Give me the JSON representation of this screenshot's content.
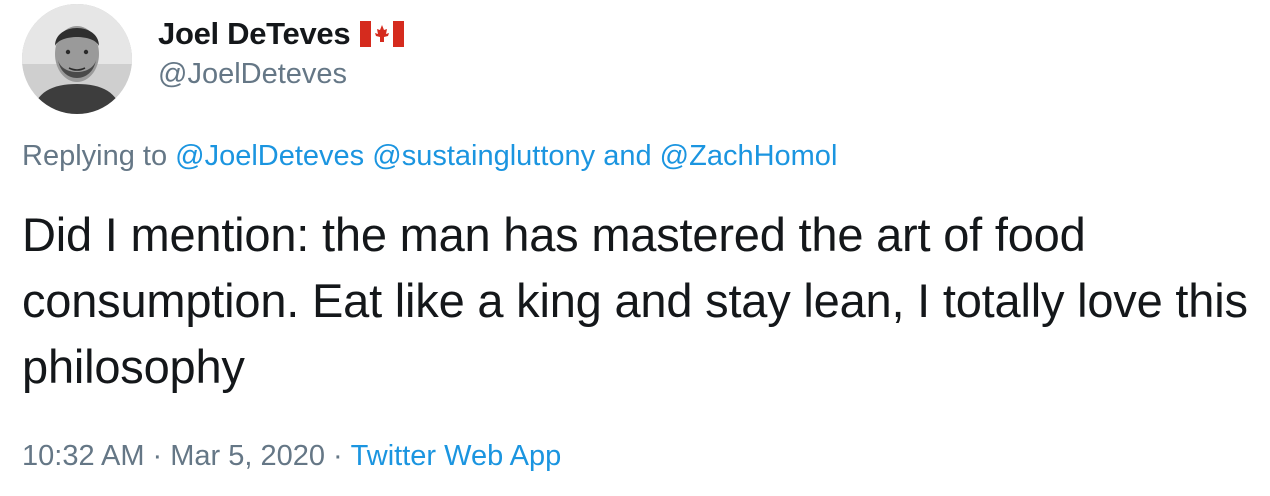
{
  "user": {
    "display_name": "Joel DeTeves",
    "handle": "@JoelDeteves",
    "flag_icon": "canada-flag-icon"
  },
  "replying": {
    "prefix": "Replying to",
    "mentions": [
      "@JoelDeteves",
      "@sustaingluttony",
      "@ZachHomol"
    ],
    "conjunction": "and"
  },
  "tweet": {
    "text": "Did I mention: the man has mastered the art of food consumption. Eat like a king and stay lean, I totally love this philosophy"
  },
  "meta": {
    "time": "10:32 AM",
    "separator": "·",
    "date": "Mar 5, 2020",
    "source": "Twitter Web App"
  },
  "colors": {
    "text": "#14171a",
    "secondary": "#657786",
    "link": "#1b95e0"
  }
}
